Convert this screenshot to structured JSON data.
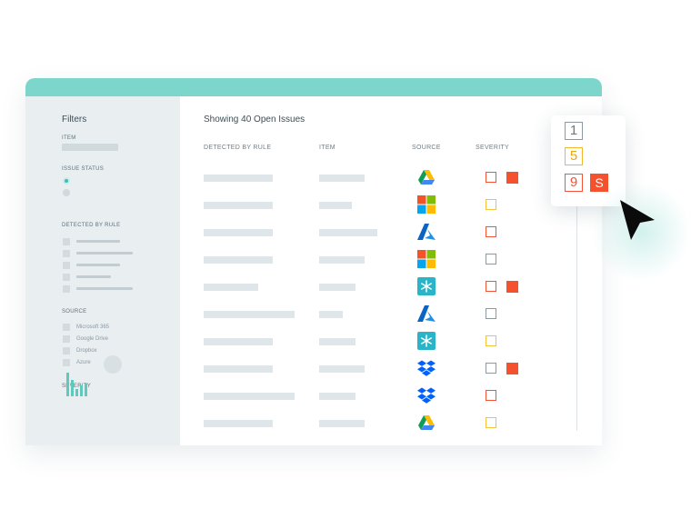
{
  "sidebar": {
    "title": "Filters",
    "item_label": "ITEM",
    "issue_status_label": "ISSUE STATUS",
    "detected_by_rule_label": "DETECTED BY RULE",
    "source_label": "SOURCE",
    "sources": [
      "Microsoft 365",
      "Google Drive",
      "Dropbox",
      "Azure"
    ],
    "severity_label": "SEVERITY",
    "radio_states": [
      true,
      false
    ]
  },
  "main": {
    "title": "Showing 40 Open Issues",
    "columns": [
      "DETECTED BY RULE",
      "ITEM",
      "SOURCE",
      "SEVERITY"
    ]
  },
  "table_rows": [
    {
      "source": "google-drive-icon",
      "severity": "high",
      "flagged": true
    },
    {
      "source": "microsoft-365-icon",
      "severity": "medium",
      "flagged": false
    },
    {
      "source": "azure-icon",
      "severity": "high",
      "flagged": false
    },
    {
      "source": "microsoft-365-icon",
      "severity": "low",
      "flagged": false
    },
    {
      "source": "snowflake-icon",
      "severity": "high",
      "flagged": true
    },
    {
      "source": "azure-icon",
      "severity": "low",
      "flagged": false
    },
    {
      "source": "snowflake-icon",
      "severity": "medium",
      "flagged": false
    },
    {
      "source": "dropbox-icon",
      "severity": "low",
      "flagged": true
    },
    {
      "source": "dropbox-icon",
      "severity": "high",
      "flagged": false
    },
    {
      "source": "google-drive-icon",
      "severity": "medium",
      "flagged": false
    }
  ],
  "severity_legend": {
    "low": "1",
    "medium": "5",
    "high": "9",
    "flagged": "S"
  },
  "colors": {
    "accent": "#7dd6cb",
    "high": "#f2543a",
    "medium": "#f5c13b",
    "low": "#8f9aa0"
  }
}
